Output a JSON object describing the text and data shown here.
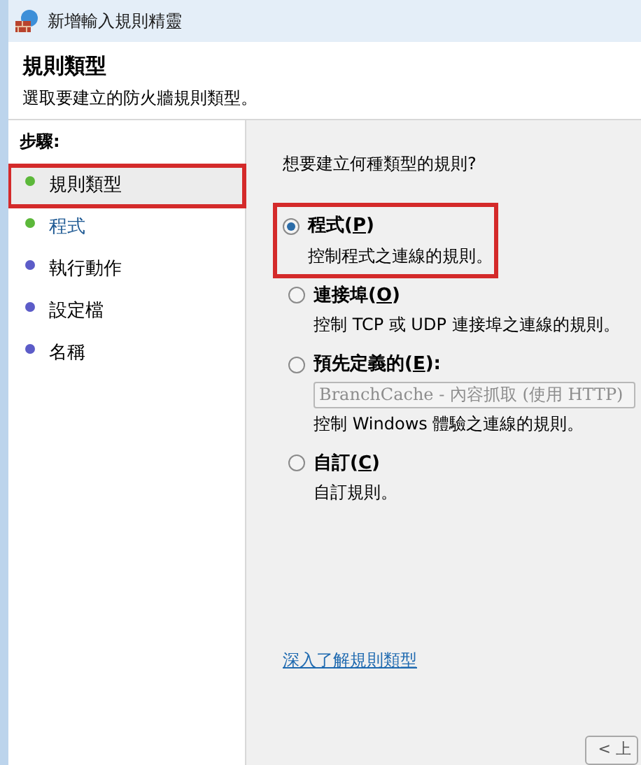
{
  "window": {
    "title": "新增輸入規則精靈"
  },
  "header": {
    "title": "規則類型",
    "subtitle": "選取要建立的防火牆規則類型。"
  },
  "steps_heading": "步驟:",
  "steps": [
    {
      "label": "規則類型",
      "selected": true,
      "color": "#5cb83a",
      "annotated": true
    },
    {
      "label": "程式",
      "selected": false,
      "color": "#5cb83a",
      "annotated": false
    },
    {
      "label": "執行動作",
      "selected": false,
      "color": "#5c5cc8",
      "annotated": false
    },
    {
      "label": "設定檔",
      "selected": false,
      "color": "#5c5cc8",
      "annotated": false
    },
    {
      "label": "名稱",
      "selected": false,
      "color": "#5c5cc8",
      "annotated": false
    }
  ],
  "question": "想要建立何種類型的規則?",
  "options": [
    {
      "label_parts": [
        "程式(",
        "P",
        ")"
      ],
      "description": "控制程式之連線的規則。",
      "selected": true,
      "annotated": true
    },
    {
      "label_parts": [
        "連接埠(",
        "O",
        ")"
      ],
      "description": "控制 TCP 或 UDP 連接埠之連線的規則。",
      "selected": false,
      "annotated": false
    },
    {
      "label_parts": [
        "預先定義的(",
        "E",
        "):"
      ],
      "dropdown": {
        "value": "BranchCache - 內容抓取 (使用 HTTP)",
        "disabled": true
      },
      "description": "控制 Windows 體驗之連線的規則。",
      "selected": false,
      "annotated": false
    },
    {
      "label_parts": [
        "自訂(",
        "C",
        ")"
      ],
      "description": "自訂規則。",
      "selected": false,
      "annotated": false
    }
  ],
  "help_link": "深入了解規則類型",
  "buttons": [
    {
      "label": "< 上"
    }
  ]
}
